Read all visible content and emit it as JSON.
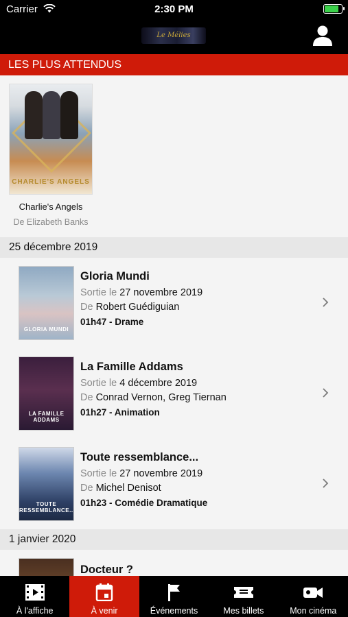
{
  "status_bar": {
    "carrier": "Carrier",
    "time": "2:30 PM"
  },
  "nav": {
    "logo_text": "Le Mélies"
  },
  "featured_section": {
    "header": "LES PLUS ATTENDUS",
    "items": [
      {
        "title": "Charlie's Angels",
        "director": "De Elizabeth Banks",
        "poster_text": "CHARLIE'S ANGELS"
      }
    ]
  },
  "groups": [
    {
      "date": "25 décembre 2019",
      "movies": [
        {
          "title": "Gloria Mundi",
          "release_prefix": "Sortie le",
          "release_date": "27 novembre 2019",
          "director_prefix": "De",
          "director": "Robert Guédiguian",
          "meta": "01h47 - Drame",
          "poster_text": "GLORIA MUNDI"
        },
        {
          "title": "La Famille Addams",
          "release_prefix": "Sortie le",
          "release_date": "4 décembre 2019",
          "director_prefix": "De",
          "director": "Conrad Vernon, Greg Tiernan",
          "meta": "01h27 - Animation",
          "poster_text": "LA FAMILLE ADDAMS"
        },
        {
          "title": "Toute ressemblance...",
          "release_prefix": "Sortie le",
          "release_date": "27 novembre 2019",
          "director_prefix": "De",
          "director": "Michel Denisot",
          "meta": "01h23 - Comédie Dramatique",
          "poster_text": "TOUTE RESSEMBLANCE..."
        }
      ]
    },
    {
      "date": "1 janvier 2020",
      "movies": [
        {
          "title": "Docteur ?"
        }
      ]
    }
  ],
  "tabs": [
    {
      "label": "À l'affiche",
      "icon": "film-icon",
      "active": false
    },
    {
      "label": "À venir",
      "icon": "calendar-icon",
      "active": true
    },
    {
      "label": "Événements",
      "icon": "flag-icon",
      "active": false
    },
    {
      "label": "Mes billets",
      "icon": "ticket-icon",
      "active": false
    },
    {
      "label": "Mon cinéma",
      "icon": "video-camera-icon",
      "active": false
    }
  ],
  "colors": {
    "accent_red": "#cf1b09",
    "bar_black": "#000000",
    "battery_green": "#3bd14a"
  }
}
